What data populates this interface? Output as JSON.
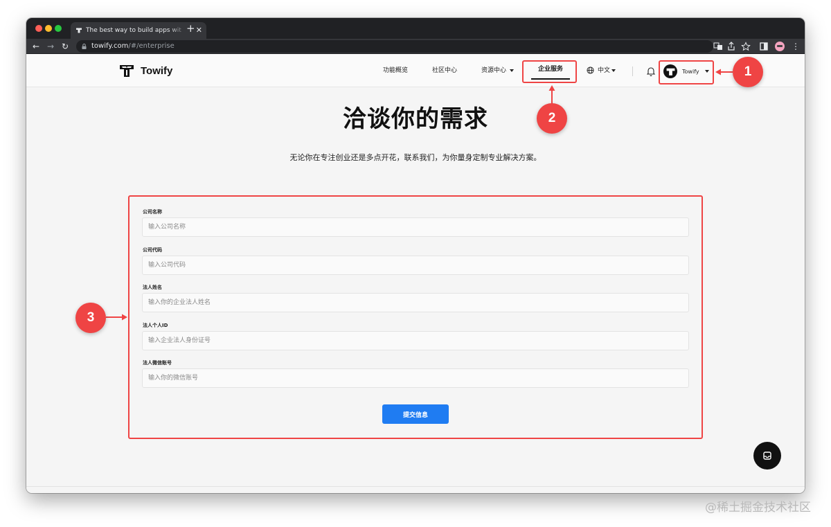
{
  "browser": {
    "tab_title": "The best way to build apps wit",
    "tab_close": "✕",
    "new_tab": "+",
    "url_host": "towify.com",
    "url_path": "/#/enterprise",
    "back": "←",
    "forward": "→",
    "reload": "↻",
    "menu": "⋮"
  },
  "header": {
    "logo_text": "Towify",
    "nav": {
      "features": "功能概览",
      "community": "社区中心",
      "resources": "资源中心",
      "enterprise": "企业服务",
      "language": "中文"
    },
    "user_name": "Towify"
  },
  "hero": {
    "title": "洽谈你的需求",
    "subtitle": "无论你在专注创业还是多点开花，联系我们，为你量身定制专业解决方案。"
  },
  "form": {
    "fields": [
      {
        "label": "公司名称",
        "placeholder": "输入公司名称"
      },
      {
        "label": "公司代码",
        "placeholder": "输入公司代码"
      },
      {
        "label": "法人姓名",
        "placeholder": "输入你的企业法人姓名"
      },
      {
        "label": "法人个人ID",
        "placeholder": "输入企业法人身份证号"
      },
      {
        "label": "法人微信账号",
        "placeholder": "输入你的微信账号"
      }
    ],
    "submit_label": "提交信息"
  },
  "annotations": {
    "badge_1": "1",
    "badge_2": "2",
    "badge_3": "3",
    "color": "#ef4444"
  },
  "watermark": "@稀土掘金技术社区",
  "colors": {
    "accent": "#1f7cf2",
    "annotation": "#ef4444"
  }
}
